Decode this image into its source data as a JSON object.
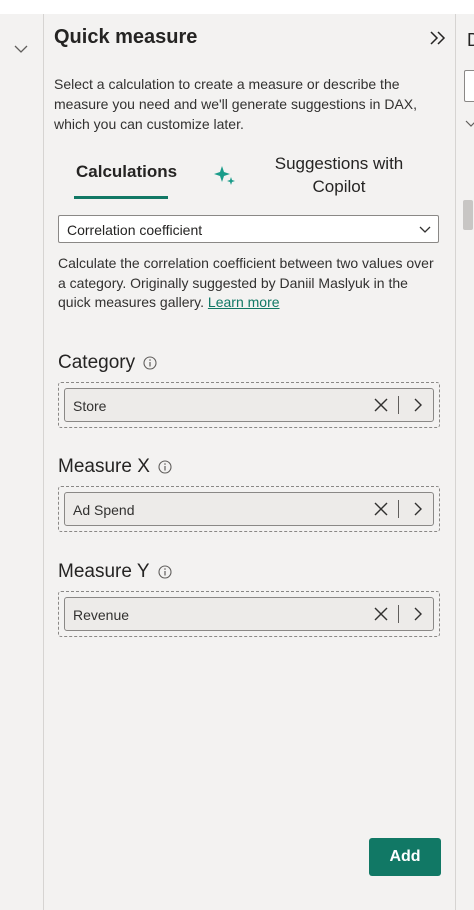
{
  "panel": {
    "title": "Quick measure",
    "description": "Select a calculation to create a measure or describe the measure you need and we'll generate suggestions in DAX, which you can customize later.",
    "collapse_icon": "double-chevron-right-icon"
  },
  "tabs": [
    {
      "label": "Calculations",
      "selected": true
    },
    {
      "label": "Suggestions with Copilot",
      "selected": false,
      "icon": "copilot-sparkle-icon"
    }
  ],
  "calculation": {
    "selected": "Correlation coefficient",
    "description": "Calculate the correlation coefficient between two values over a category. Originally suggested by Daniil Maslyuk in the quick measures gallery.",
    "learn_more": "Learn more"
  },
  "fields": [
    {
      "label": "Category",
      "value": "Store"
    },
    {
      "label": "Measure X",
      "value": "Ad Spend"
    },
    {
      "label": "Measure Y",
      "value": "Revenue"
    }
  ],
  "right_pane": {
    "header_letter": "D"
  },
  "add_label": "Add",
  "colors": {
    "accent": "#117865",
    "background": "#f3f2f1"
  }
}
